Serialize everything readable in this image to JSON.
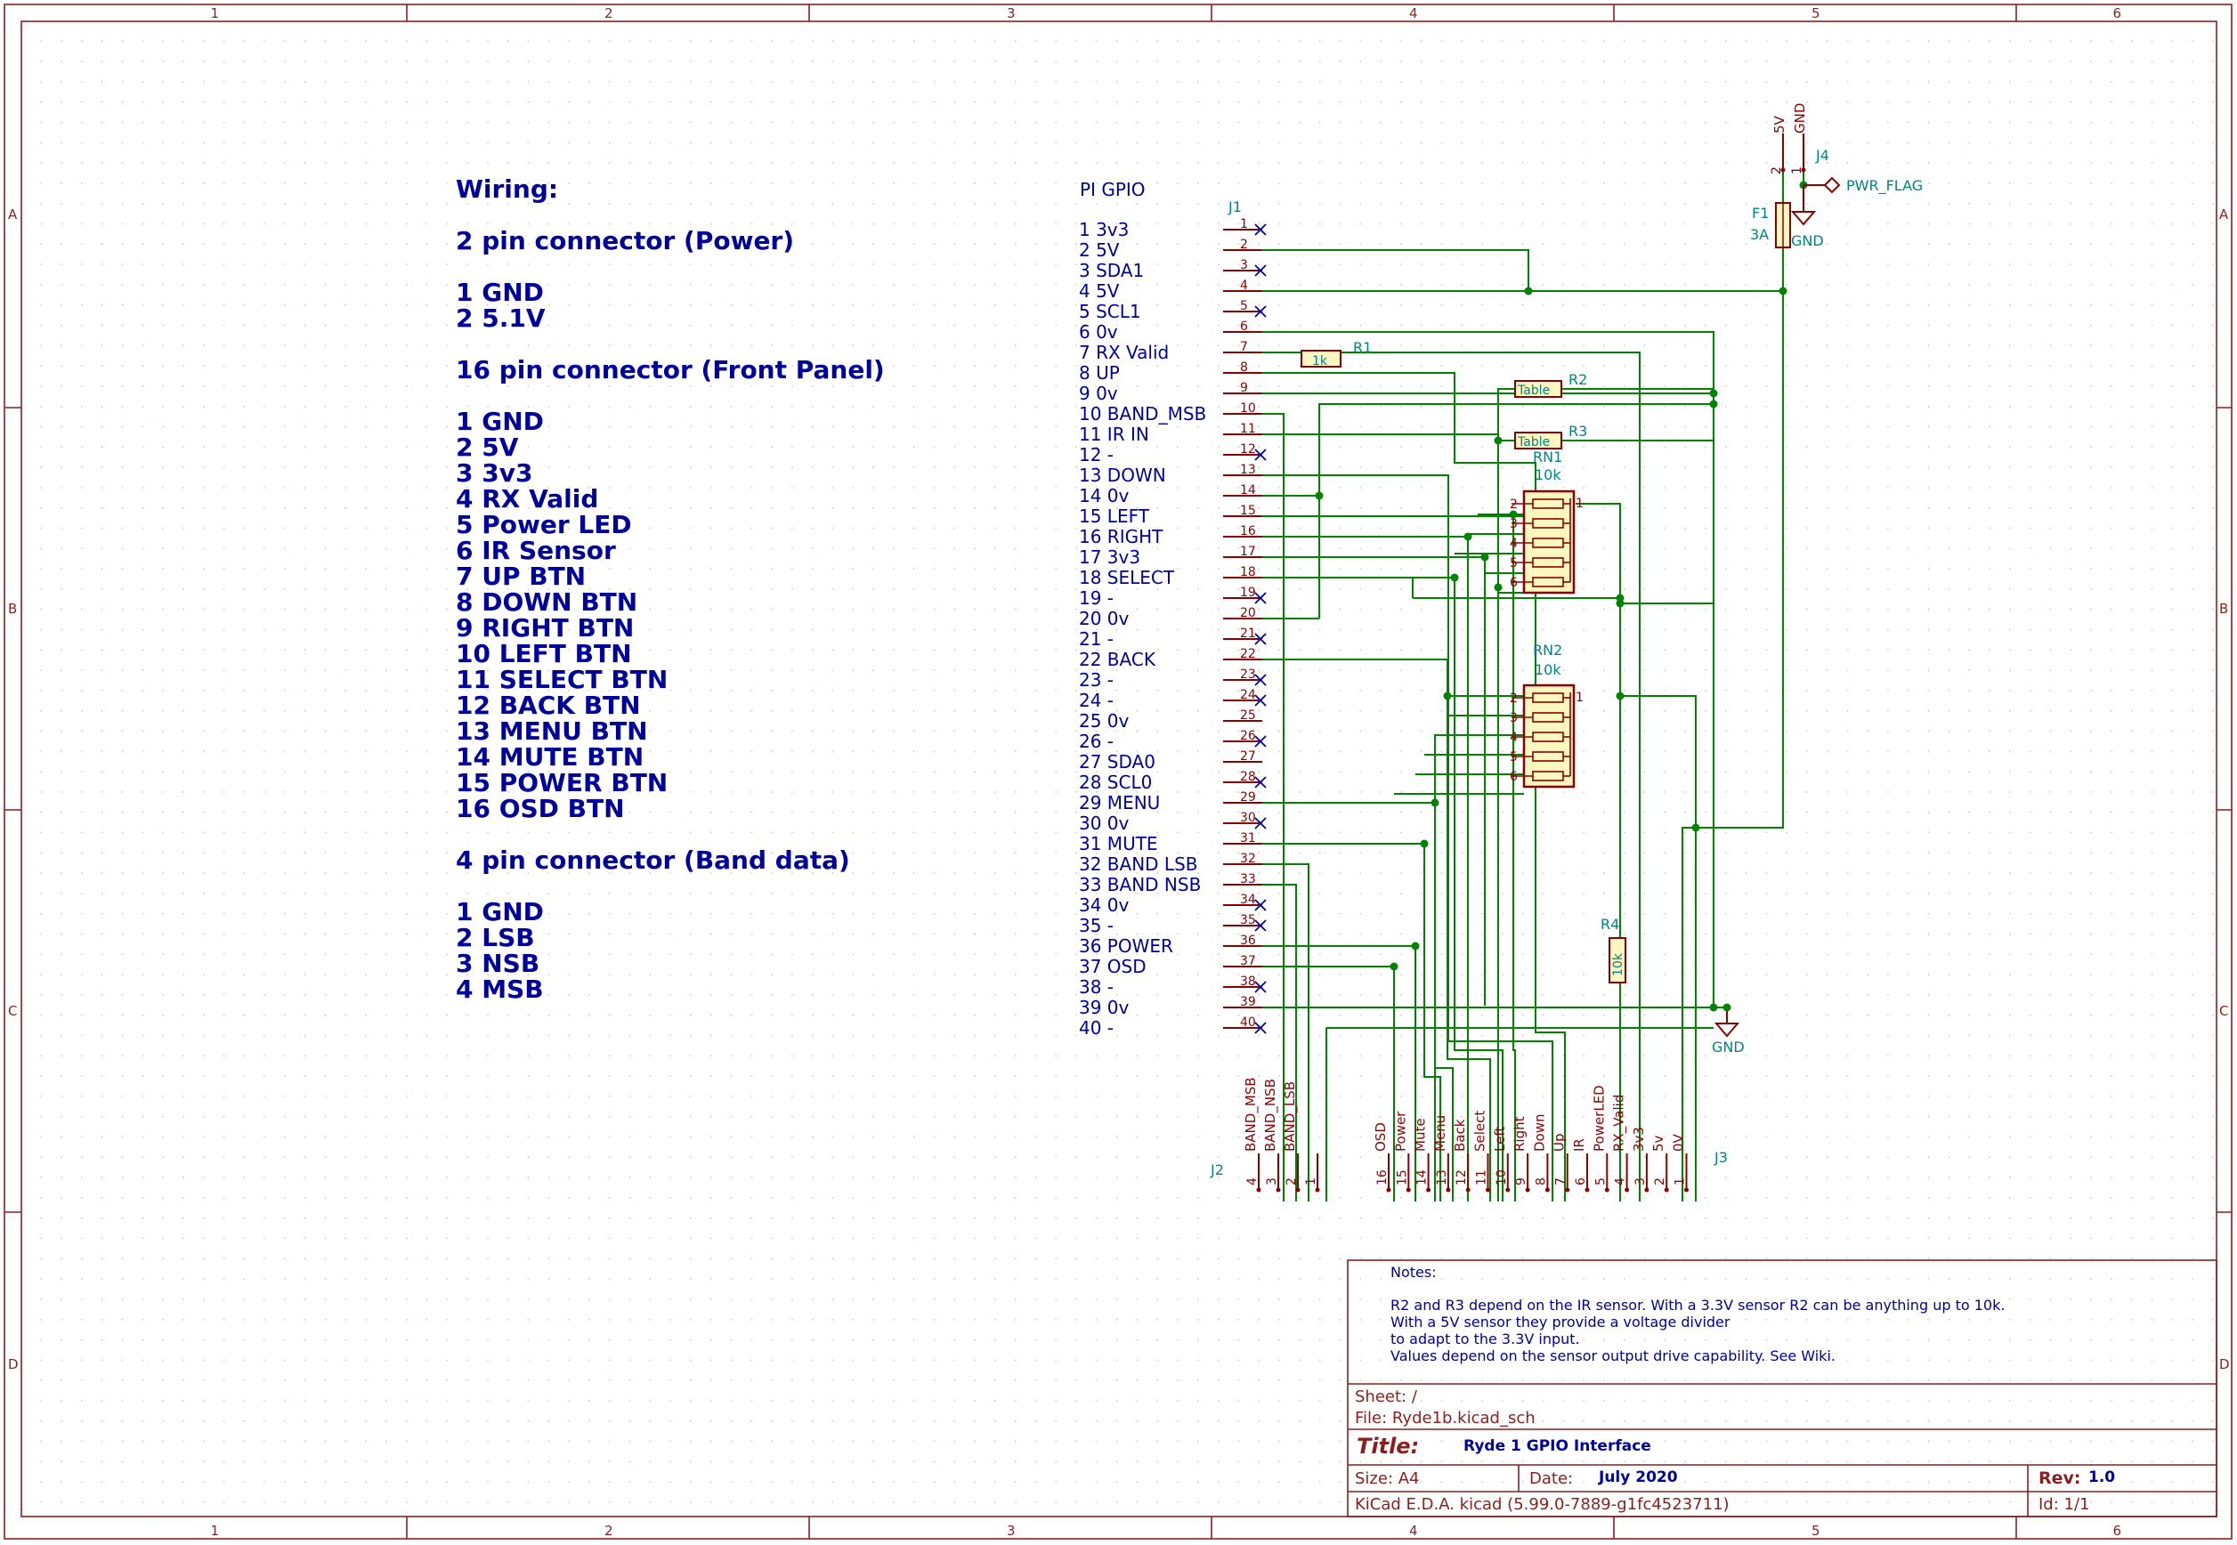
{
  "frame": {
    "cols": [
      "1",
      "2",
      "3",
      "4",
      "5",
      "6"
    ],
    "rows": [
      "A",
      "B",
      "C",
      "D"
    ]
  },
  "colors": {
    "border": "#8a1f1f",
    "wire": "#008400",
    "text": "#00009c",
    "component": "#8b0000",
    "ref": "#008484",
    "grid": "#b0b0b0"
  },
  "wiring": [
    "Wiring:",
    "",
    "2 pin connector (Power)",
    "",
    "1  GND",
    "2  5.1V",
    "",
    "16 pin connector (Front Panel)",
    "",
    "1  GND",
    "2  5V",
    "3  3v3",
    "4  RX Valid",
    "5  Power LED",
    "6  IR Sensor",
    "7  UP BTN",
    "8  DOWN BTN",
    "9  RIGHT BTN",
    "10 LEFT BTN",
    "11 SELECT BTN",
    "12 BACK BTN",
    "13 MENU BTN",
    "14 MUTE BTN",
    "15 POWER BTN",
    "16 OSD BTN",
    "",
    "4 pin connector (Band data)",
    "",
    "1  GND",
    "2  LSB",
    "3  NSB",
    "4  MSB"
  ],
  "gpio": {
    "title": "PI GPIO",
    "pins": [
      "1  3v3",
      "2  5V",
      "3  SDA1",
      "4  5V",
      "5  SCL1",
      "6  0v",
      "7  RX Valid",
      "8  UP",
      "9  0v",
      "10  BAND_MSB",
      "11  IR IN",
      "12  -",
      "13  DOWN",
      "14  0v",
      "15  LEFT",
      "16  RIGHT",
      "17  3v3",
      "18  SELECT",
      "19  -",
      "20  0v",
      "21  -",
      "22  BACK",
      "23  -",
      "24  -",
      "25  0v",
      "26  -",
      "27  SDA0",
      "28  SCL0",
      "29  MENU",
      "30  0v",
      "31  MUTE",
      "32  BAND LSB",
      "33  BAND NSB",
      "34  0v",
      "35  -",
      "36  POWER",
      "37  OSD",
      "38  -",
      "39  0v",
      "40  -"
    ]
  },
  "j1": {
    "ref": "J1",
    "pin_numbers": [
      "1",
      "2",
      "3",
      "4",
      "5",
      "6",
      "7",
      "8",
      "9",
      "10",
      "11",
      "12",
      "13",
      "14",
      "15",
      "16",
      "17",
      "18",
      "19",
      "20",
      "21",
      "22",
      "23",
      "24",
      "25",
      "26",
      "27",
      "28",
      "29",
      "30",
      "31",
      "32",
      "33",
      "34",
      "35",
      "36",
      "37",
      "38",
      "39",
      "40"
    ]
  },
  "components": {
    "r1": {
      "ref": "R1",
      "value": "1k"
    },
    "r2": {
      "ref": "R2",
      "value": "Table"
    },
    "r3": {
      "ref": "R3",
      "value": "Table"
    },
    "rn1": {
      "ref": "RN1",
      "value": "10k",
      "pins": [
        "2",
        "3",
        "4",
        "5",
        "6"
      ],
      "common": "1"
    },
    "rn2": {
      "ref": "RN2",
      "value": "10k",
      "pins": [
        "2",
        "3",
        "4",
        "5",
        "6"
      ],
      "common": "1"
    },
    "r4": {
      "ref": "R4",
      "value": "10k"
    },
    "f1": {
      "ref": "F1",
      "value": "3A"
    },
    "j4": {
      "ref": "J4",
      "pins": [
        "2",
        "1"
      ],
      "labels": [
        "5V",
        "GND"
      ]
    },
    "pwr_flag": "PWR_FLAG",
    "gnd_top": "GND",
    "gnd_bottom": "GND"
  },
  "j2": {
    "ref": "J2",
    "pins": [
      {
        "num": "4",
        "label": "BAND_MSB"
      },
      {
        "num": "3",
        "label": "BAND_NSB"
      },
      {
        "num": "2",
        "label": "BAND_LSB"
      },
      {
        "num": "1",
        "label": ""
      }
    ]
  },
  "j3": {
    "ref": "J3",
    "pins": [
      {
        "num": "16",
        "label": "OSD"
      },
      {
        "num": "15",
        "label": "Power"
      },
      {
        "num": "14",
        "label": "Mute"
      },
      {
        "num": "13",
        "label": "Menu"
      },
      {
        "num": "12",
        "label": "Back"
      },
      {
        "num": "11",
        "label": "Select"
      },
      {
        "num": "10",
        "label": "Left"
      },
      {
        "num": "9",
        "label": "Right"
      },
      {
        "num": "8",
        "label": "Down"
      },
      {
        "num": "7",
        "label": "Up"
      },
      {
        "num": "6",
        "label": "IR"
      },
      {
        "num": "5",
        "label": "PowerLED"
      },
      {
        "num": "4",
        "label": "RX_Valid"
      },
      {
        "num": "3",
        "label": "3v3"
      },
      {
        "num": "2",
        "label": "5v"
      },
      {
        "num": "1",
        "label": "0V"
      }
    ]
  },
  "titleblock": {
    "notes_label": "Notes:",
    "notes": [
      "R2 and R3 depend on the IR sensor.  With a 3.3V sensor R2 can be anything up to 10k.",
      "With a 5V sensor they provide a voltage divider",
      "to adapt to the 3.3V input.",
      "Values depend on the sensor output drive capability. See Wiki."
    ],
    "sheet": "Sheet: /",
    "file": "File: Ryde1b.kicad_sch",
    "title_label": "Title:",
    "title": "Ryde 1 GPIO Interface",
    "size": "Size: A4",
    "date_label": "Date:",
    "date": "July 2020",
    "rev_label": "Rev:",
    "rev": "1.0",
    "kicad": "KiCad E.D.A.  kicad (5.99.0-7889-g1fc4523711)",
    "id": "Id: 1/1"
  }
}
